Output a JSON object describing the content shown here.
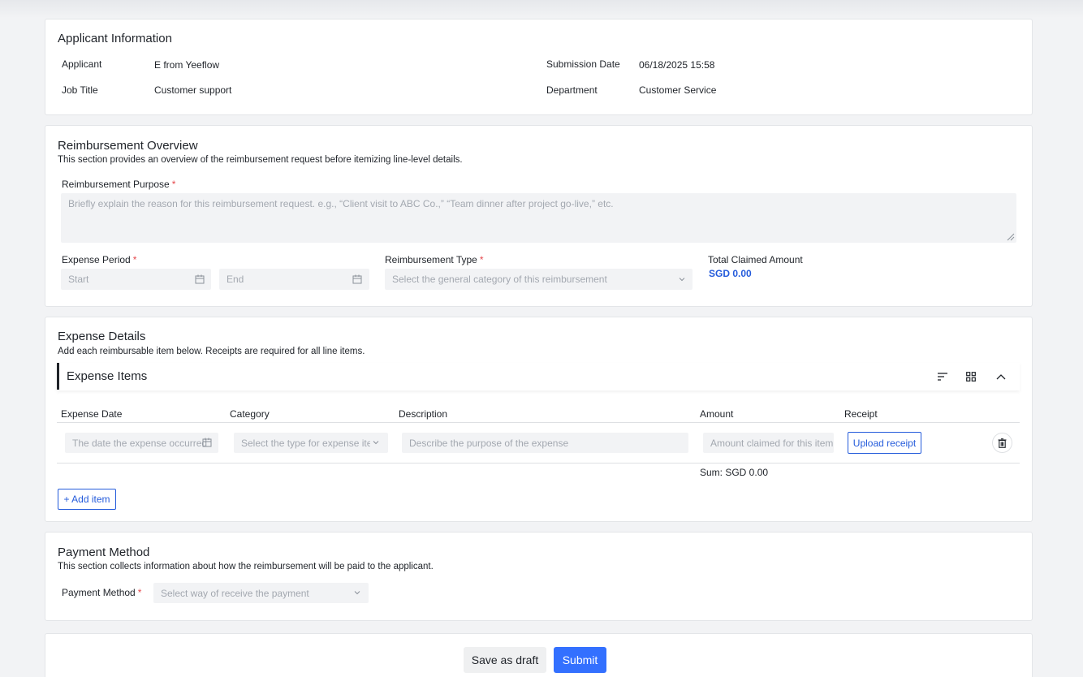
{
  "applicant": {
    "title": "Applicant Information",
    "applicant_label": "Applicant",
    "applicant_value": "E from Yeeflow",
    "job_title_label": "Job Title",
    "job_title_value": "Customer support",
    "submission_date_label": "Submission Date",
    "submission_date_value": "06/18/2025 15:58",
    "department_label": "Department",
    "department_value": "Customer Service"
  },
  "overview": {
    "title": "Reimbursement Overview",
    "description": "This section provides an overview of the reimbursement request before itemizing line-level details.",
    "purpose_label": "Reimbursement Purpose",
    "purpose_placeholder": "Briefly explain the reason for this reimbursement request. e.g., “Client visit to ABC Co.,” “Team dinner after project go-live,” etc.",
    "period_label": "Expense Period",
    "start_placeholder": "Start",
    "end_placeholder": "End",
    "type_label": "Reimbursement Type",
    "type_placeholder": "Select the general category of this reimbursement",
    "total_label": "Total Claimed Amount",
    "total_value": "SGD 0.00",
    "required_mark": "*"
  },
  "expense": {
    "title": "Expense Details",
    "description": "Add each reimbursable item below. Receipts are required for all line items.",
    "section_title": "Expense Items",
    "columns": [
      "Expense Date",
      "Category",
      "Description",
      "Amount",
      "Receipt"
    ],
    "row": {
      "date_placeholder": "The date the expense occurred",
      "category_placeholder": "Select the type for expense item",
      "description_placeholder": "Describe the purpose of the expense",
      "amount_placeholder": "Amount claimed for this item",
      "upload_label": "Upload receipt"
    },
    "sum": "Sum: SGD 0.00",
    "add_item": "+ Add item"
  },
  "payment": {
    "title": "Payment Method",
    "description": "This section collects information about how the reimbursement will be paid to the applicant.",
    "method_label": "Payment Method",
    "method_placeholder": "Select way of receive the payment"
  },
  "footer": {
    "draft_label": "Save as draft",
    "submit_label": "Submit"
  },
  "colors": {
    "accent": "#3370ff",
    "link": "#245bdb",
    "required": "#e5484d"
  }
}
